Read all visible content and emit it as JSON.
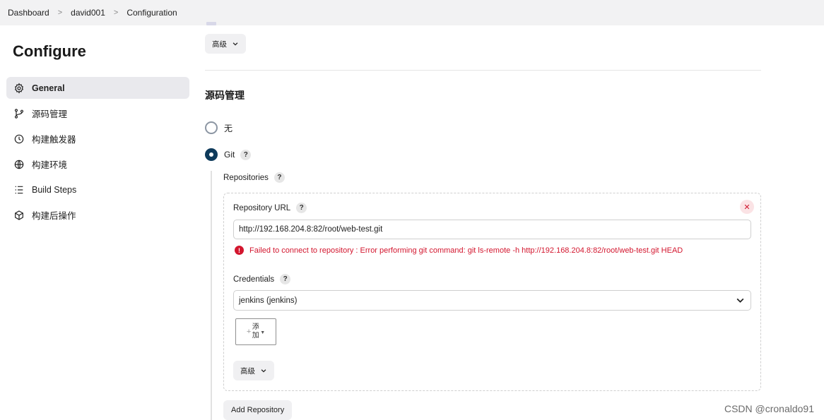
{
  "breadcrumb": {
    "items": [
      "Dashboard",
      "david001",
      "Configuration"
    ]
  },
  "sidebar": {
    "title": "Configure",
    "items": [
      {
        "label": "General",
        "icon": "gear-icon",
        "active": true
      },
      {
        "label": "源码管理",
        "icon": "branch-icon"
      },
      {
        "label": "构建触发器",
        "icon": "clock-icon"
      },
      {
        "label": "构建环境",
        "icon": "globe-icon"
      },
      {
        "label": "Build Steps",
        "icon": "list-icon"
      },
      {
        "label": "构建后操作",
        "icon": "package-icon"
      }
    ]
  },
  "main": {
    "top_advanced_label": "高级",
    "section_title": "源码管理",
    "radio_none_label": "无",
    "radio_git_label": "Git",
    "help_glyph": "?",
    "repositories_label": "Repositories",
    "repository_url_label": "Repository URL",
    "repository_url_value": "http://192.168.204.8:82/root/web-test.git",
    "error_text": "Failed to connect to repository : Error performing git command: git ls-remote -h http://192.168.204.8:82/root/web-test.git HEAD",
    "credentials_label": "Credentials",
    "credentials_selected": "jenkins (jenkins)",
    "add_button_label": "添加",
    "inner_advanced_label": "高级",
    "add_repository_label": "Add Repository"
  },
  "watermark": "CSDN @cronaldo91",
  "colors": {
    "radio_selected": "#0e3a5b",
    "error": "#d3162e",
    "sidebar_active_bg": "#e9e9ed"
  }
}
